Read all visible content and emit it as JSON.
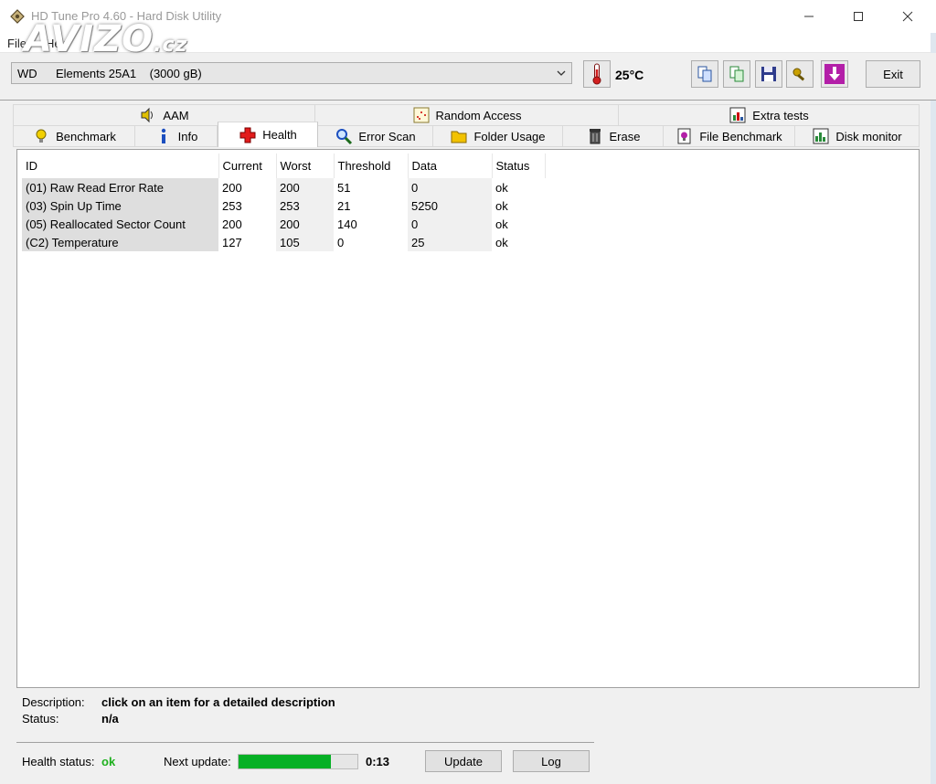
{
  "window": {
    "title": "HD Tune Pro 4.60 - Hard Disk Utility",
    "watermark_main": "AVIZO",
    "watermark_suffix": ".cz"
  },
  "menu": {
    "file": "File",
    "help": "Help"
  },
  "toolbar": {
    "drive_brand": "WD",
    "drive_model": "Elements 25A1    (3000 gB)",
    "temperature": "25°C",
    "exit_label": "Exit"
  },
  "tabs_row1": [
    {
      "label": "AAM",
      "icon": "speaker-icon"
    },
    {
      "label": "Random Access",
      "icon": "scatter-icon"
    },
    {
      "label": "Extra tests",
      "icon": "chart-icon"
    }
  ],
  "tabs_row2": [
    {
      "label": "Benchmark",
      "icon": "lightbulb-icon"
    },
    {
      "label": "Info",
      "icon": "info-icon"
    },
    {
      "label": "Health",
      "icon": "cross-icon",
      "active": true
    },
    {
      "label": "Error Scan",
      "icon": "magnifier-icon"
    },
    {
      "label": "Folder Usage",
      "icon": "folder-icon"
    },
    {
      "label": "Erase",
      "icon": "trash-icon"
    },
    {
      "label": "File Benchmark",
      "icon": "file-bulb-icon"
    },
    {
      "label": "Disk monitor",
      "icon": "monitor-chart-icon"
    }
  ],
  "table": {
    "headers": [
      "ID",
      "Current",
      "Worst",
      "Threshold",
      "Data",
      "Status"
    ],
    "rows": [
      [
        "(01) Raw Read Error Rate",
        "200",
        "200",
        "51",
        "0",
        "ok"
      ],
      [
        "(03) Spin Up Time",
        "253",
        "253",
        "21",
        "5250",
        "ok"
      ],
      [
        "(05) Reallocated Sector Count",
        "200",
        "200",
        "140",
        "0",
        "ok"
      ],
      [
        "(C2) Temperature",
        "127",
        "105",
        "0",
        "25",
        "ok"
      ]
    ]
  },
  "description": {
    "label": "Description:",
    "value": "click on an item for a detailed description",
    "status_label": "Status:",
    "status_value": "n/a"
  },
  "footer": {
    "health_status_label": "Health status:",
    "health_status_value": "ok",
    "next_update_label": "Next update:",
    "progress_fraction": 0.78,
    "next_update_value": "0:13",
    "update_label": "Update",
    "log_label": "Log"
  },
  "colors": {
    "ok_green": "#1db01d",
    "progress_green": "#06b025"
  }
}
